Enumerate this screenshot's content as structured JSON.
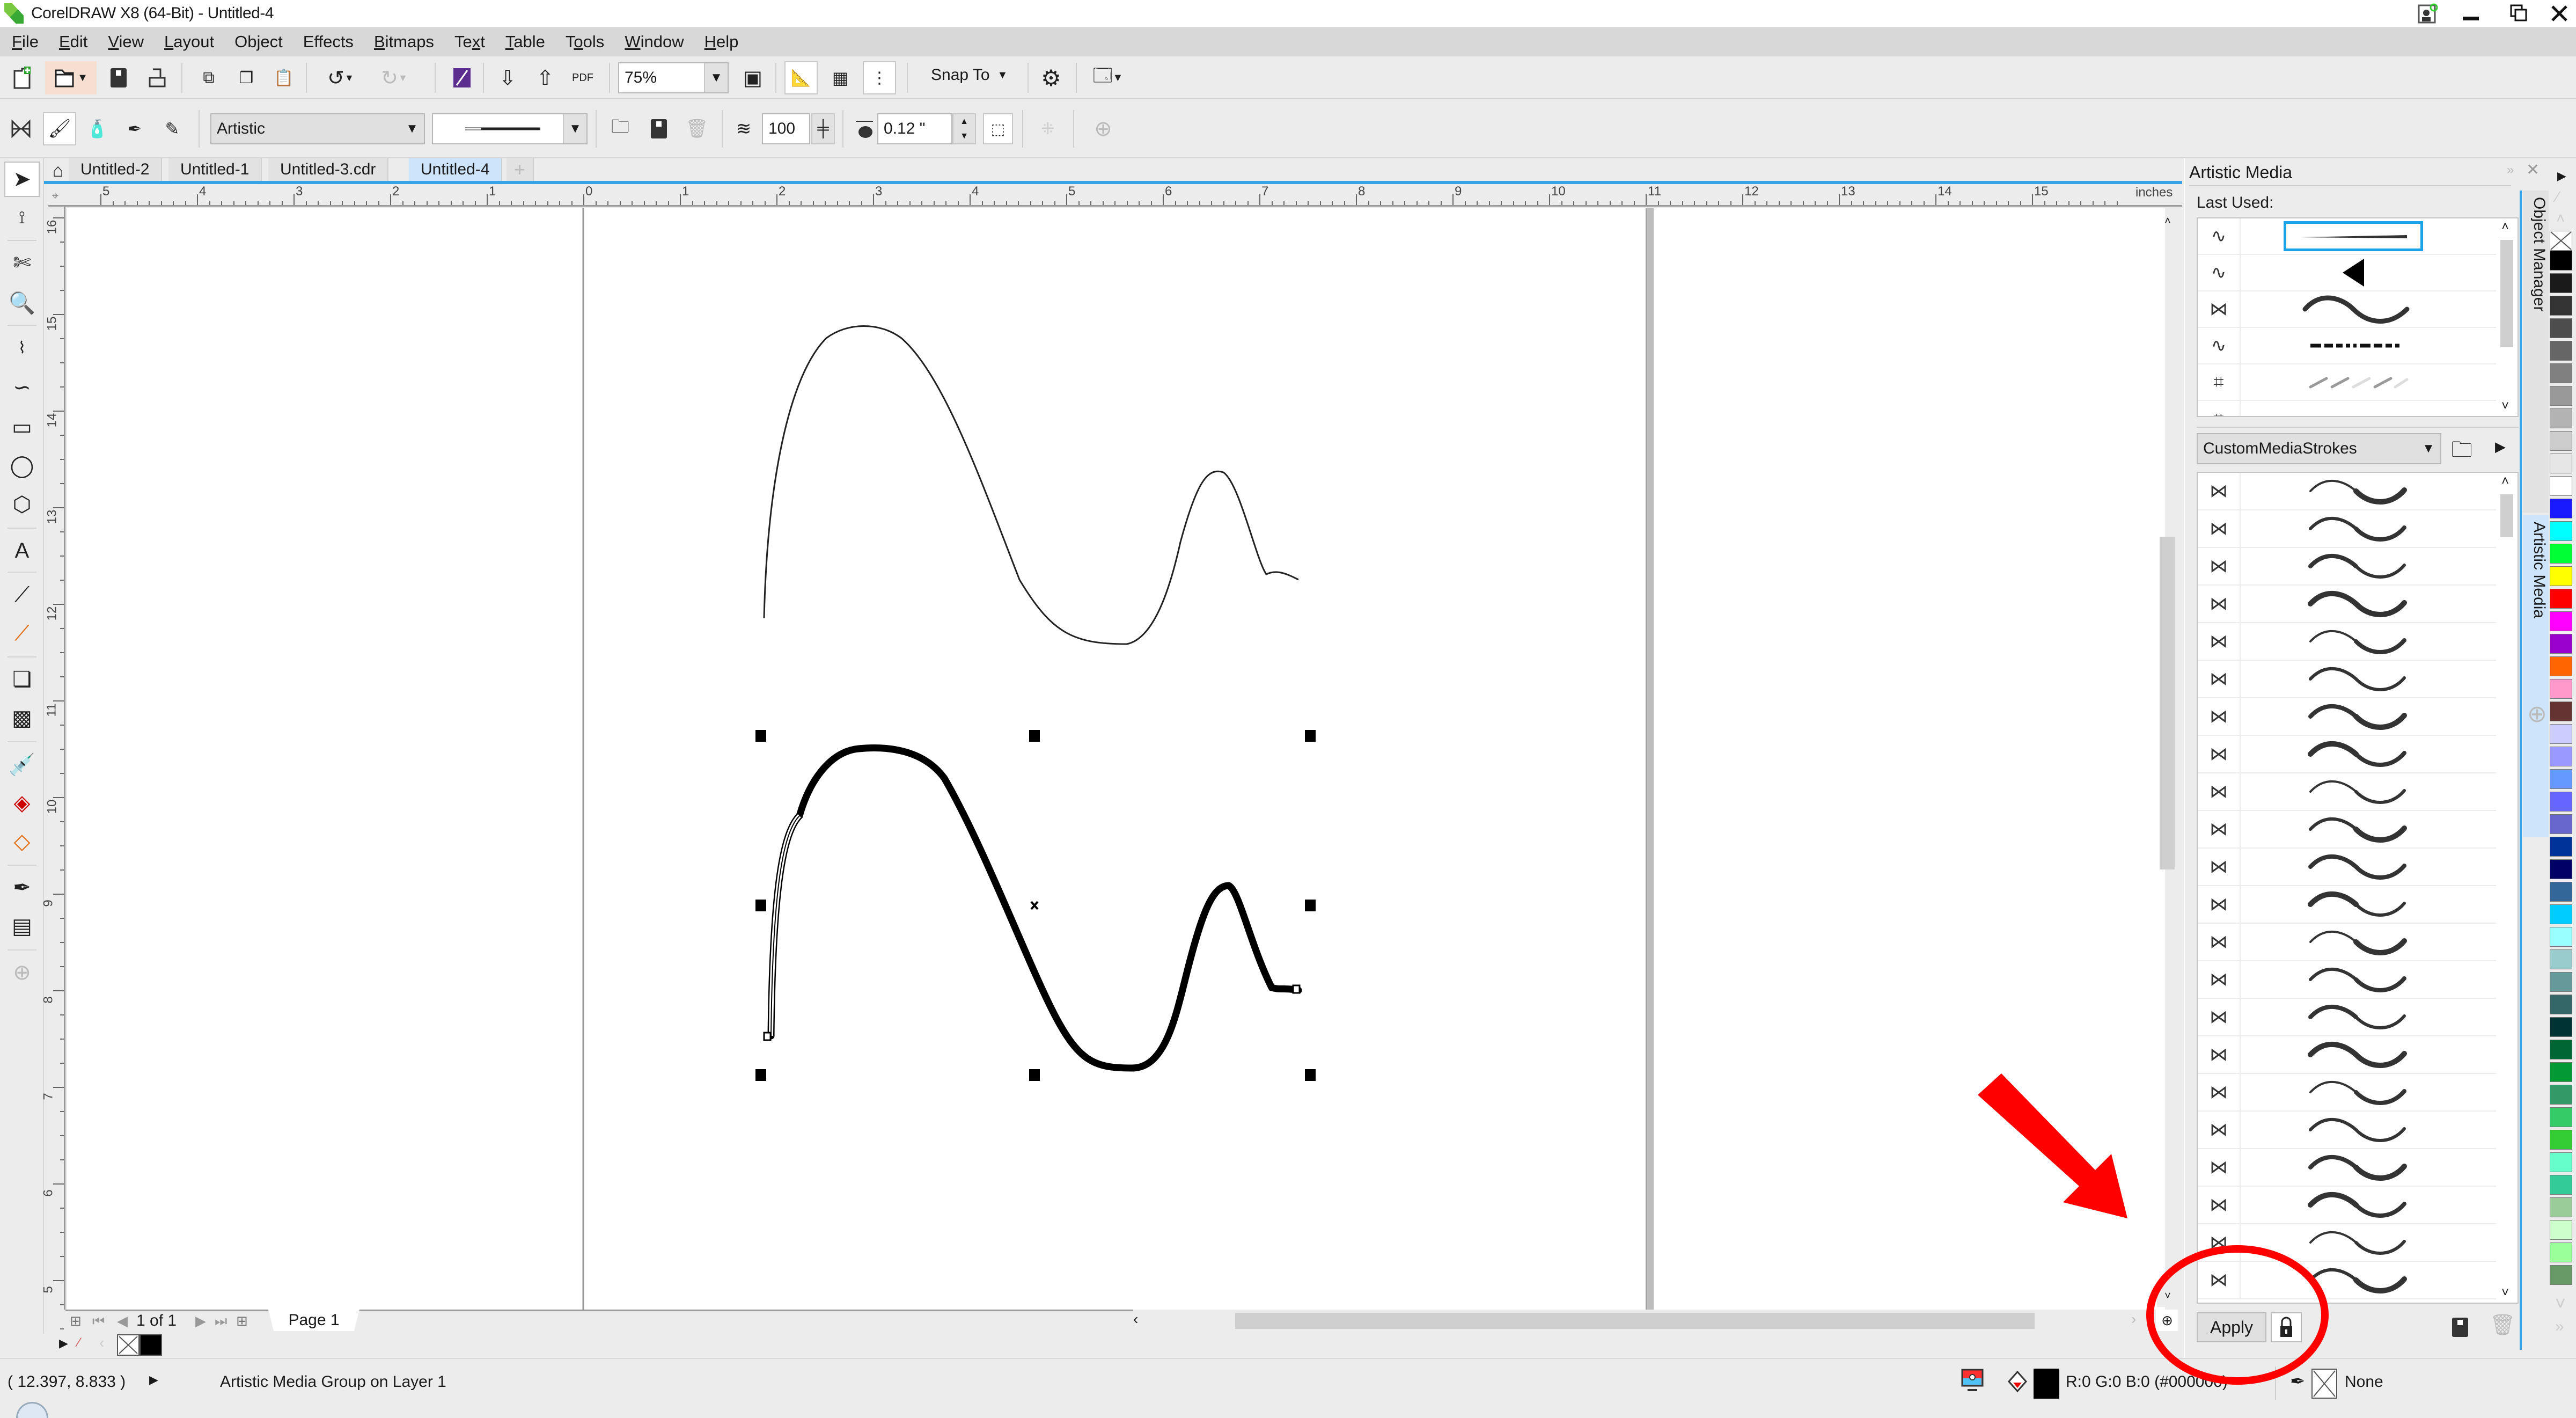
{
  "window": {
    "title": "CorelDRAW X8 (64-Bit) - Untitled-4",
    "controls": {
      "account": "account-icon",
      "minimize": "–",
      "restore": "❐",
      "close": "✕"
    }
  },
  "menu": [
    {
      "label": "File",
      "key": "F"
    },
    {
      "label": "Edit",
      "key": "E"
    },
    {
      "label": "View",
      "key": "V"
    },
    {
      "label": "Layout",
      "key": "L"
    },
    {
      "label": "Object",
      "key": "j"
    },
    {
      "label": "Effects",
      "key": "C"
    },
    {
      "label": "Bitmaps",
      "key": "B"
    },
    {
      "label": "Text",
      "key": "x"
    },
    {
      "label": "Table",
      "key": "T"
    },
    {
      "label": "Tools",
      "key": "o"
    },
    {
      "label": "Window",
      "key": "W"
    },
    {
      "label": "Help",
      "key": "H"
    }
  ],
  "standard_toolbar": {
    "zoom_level": "75%",
    "snap_to": "Snap To",
    "pdf_label": "PDF"
  },
  "property_bar": {
    "preset_category": "Artistic",
    "stroke_smoothing": "100",
    "stroke_width": "0.12 \""
  },
  "doc_tabs": [
    {
      "label": "Untitled-2",
      "active": false
    },
    {
      "label": "Untitled-1",
      "active": false
    },
    {
      "label": "Untitled-3.cdr",
      "active": false
    },
    {
      "label": "Untitled-4",
      "active": true
    }
  ],
  "ruler": {
    "unit": "inches",
    "h_labels": [
      "5",
      "4",
      "3",
      "2",
      "1",
      "0",
      "1",
      "2",
      "3",
      "4",
      "5",
      "6",
      "7",
      "8",
      "9",
      "10",
      "11",
      "12",
      "13",
      "14",
      "15"
    ],
    "v_labels": [
      "16",
      "15",
      "14",
      "13",
      "12",
      "11",
      "10",
      "9",
      "8",
      "7",
      "6",
      "5"
    ]
  },
  "page_nav": {
    "counter": "1 of 1",
    "page_tab": "Page 1"
  },
  "status": {
    "coords": "( 12.397, 8.833 )",
    "selection": "Artistic Media Group on Layer 1",
    "fill_color": "R:0 G:0 B:0 (#000000)",
    "outline": "None"
  },
  "docker": {
    "title": "Artistic Media",
    "last_used_label": "Last Used:",
    "last_used": [
      {
        "icon": "preset-icon",
        "preview": "tapered-line",
        "selected": true
      },
      {
        "icon": "preset-icon",
        "preview": "triangle"
      },
      {
        "icon": "brush-icon",
        "preview": "wave"
      },
      {
        "icon": "preset-icon",
        "preview": "dash-line"
      },
      {
        "icon": "sprayer-icon",
        "preview": "spray-strokes"
      }
    ],
    "library": "CustomMediaStrokes",
    "stroke_count": 22,
    "apply_label": "Apply",
    "side_tabs": [
      "Object Manager",
      "Artistic Media"
    ]
  },
  "palette": [
    "#000000",
    "#1a1a1a",
    "#333333",
    "#4d4d4d",
    "#666666",
    "#808080",
    "#999999",
    "#b3b3b3",
    "#cccccc",
    "#e6e6e6",
    "#ffffff",
    "#1a1aff",
    "#00ffff",
    "#00ff33",
    "#ffff00",
    "#ff0000",
    "#ff00ff",
    "#9900cc",
    "#ff6600",
    "#ff99cc",
    "#663333",
    "#ccccff",
    "#9999ff",
    "#6699ff",
    "#6666ff",
    "#6666cc",
    "#003399",
    "#000066",
    "#336699",
    "#00ccff",
    "#99ffff",
    "#99cccc",
    "#669999",
    "#336666",
    "#003333",
    "#006633",
    "#009933",
    "#339966",
    "#33cc66",
    "#33cc33",
    "#66ffcc",
    "#33cc99",
    "#99cc99",
    "#ccffcc",
    "#99ff99",
    "#669966"
  ],
  "annotation": {
    "arrow_color": "#ff0000",
    "circle_color": "#ff0000"
  }
}
